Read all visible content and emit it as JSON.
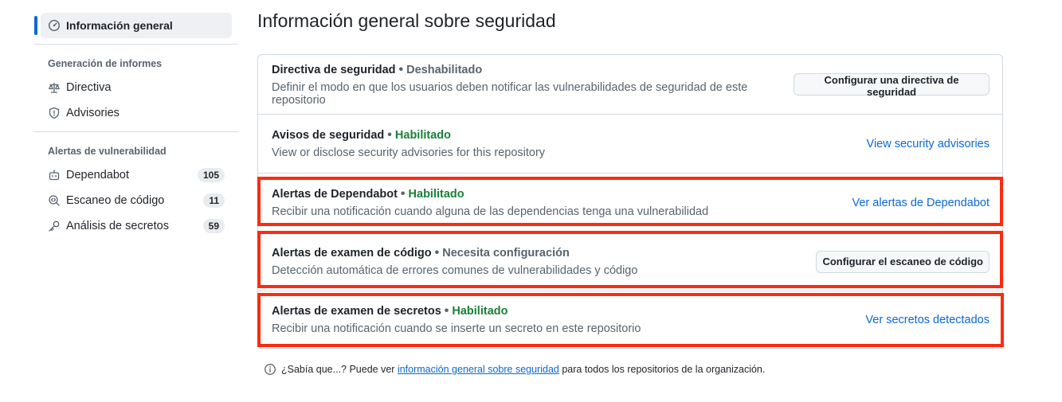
{
  "sidebar": {
    "active": {
      "label": "Información general",
      "icon": "shield-check-icon"
    },
    "groups": [
      {
        "title": "Generación de informes",
        "items": [
          {
            "label": "Directiva",
            "icon": "law-icon"
          },
          {
            "label": "Advisories",
            "icon": "shield-icon"
          }
        ]
      },
      {
        "title": "Alertas de vulnerabilidad",
        "items": [
          {
            "label": "Dependabot",
            "icon": "dependabot-icon",
            "count": "105"
          },
          {
            "label": "Escaneo de código",
            "icon": "code-scan-icon",
            "count": "11"
          },
          {
            "label": "Análisis de secretos",
            "icon": "key-icon",
            "count": "59"
          }
        ]
      }
    ]
  },
  "main": {
    "title": "Información general sobre seguridad",
    "rows": [
      {
        "title": "Directiva de seguridad",
        "separator": "•",
        "status": "Deshabilitado",
        "status_type": "off",
        "description": "Definir el modo en que los usuarios deben notificar las vulnerabilidades de seguridad de este repositorio",
        "action_type": "button",
        "action_label": "Configurar una directiva de seguridad",
        "highlighted": false
      },
      {
        "title": "Avisos de seguridad",
        "separator": "•",
        "status": "Habilitado",
        "status_type": "on",
        "description": "View or disclose security advisories for this repository",
        "action_type": "link",
        "action_label": "View security advisories",
        "highlighted": false
      },
      {
        "title": "Alertas de Dependabot",
        "separator": "•",
        "status": "Habilitado",
        "status_type": "on",
        "description": "Recibir una notificación cuando alguna de las dependencias tenga una vulnerabilidad",
        "action_type": "link",
        "action_label": "Ver alertas de Dependabot",
        "highlighted": true
      },
      {
        "title": "Alertas de examen de código",
        "separator": "•",
        "status": "Necesita configuración",
        "status_type": "off",
        "description": "Detección automática de errores comunes de vulnerabilidades y código",
        "action_type": "button",
        "action_label": "Configurar el escaneo de código",
        "highlighted": true
      },
      {
        "title": "Alertas de examen de secretos",
        "separator": "•",
        "status": "Habilitado",
        "status_type": "on",
        "description": "Recibir una notificación cuando se inserte un secreto en este repositorio",
        "action_type": "link",
        "action_label": "Ver secretos detectados",
        "highlighted": true
      }
    ],
    "footnote": {
      "icon": "info-icon",
      "prefix": "¿Sabía que...? Puede ver",
      "link": "información general sobre seguridad",
      "suffix": "para todos los repositorios de la organización."
    }
  },
  "colors": {
    "accent": "#0969da",
    "enabled": "#1a7f37",
    "muted": "#59636e",
    "highlight": "#ff2a0e"
  }
}
